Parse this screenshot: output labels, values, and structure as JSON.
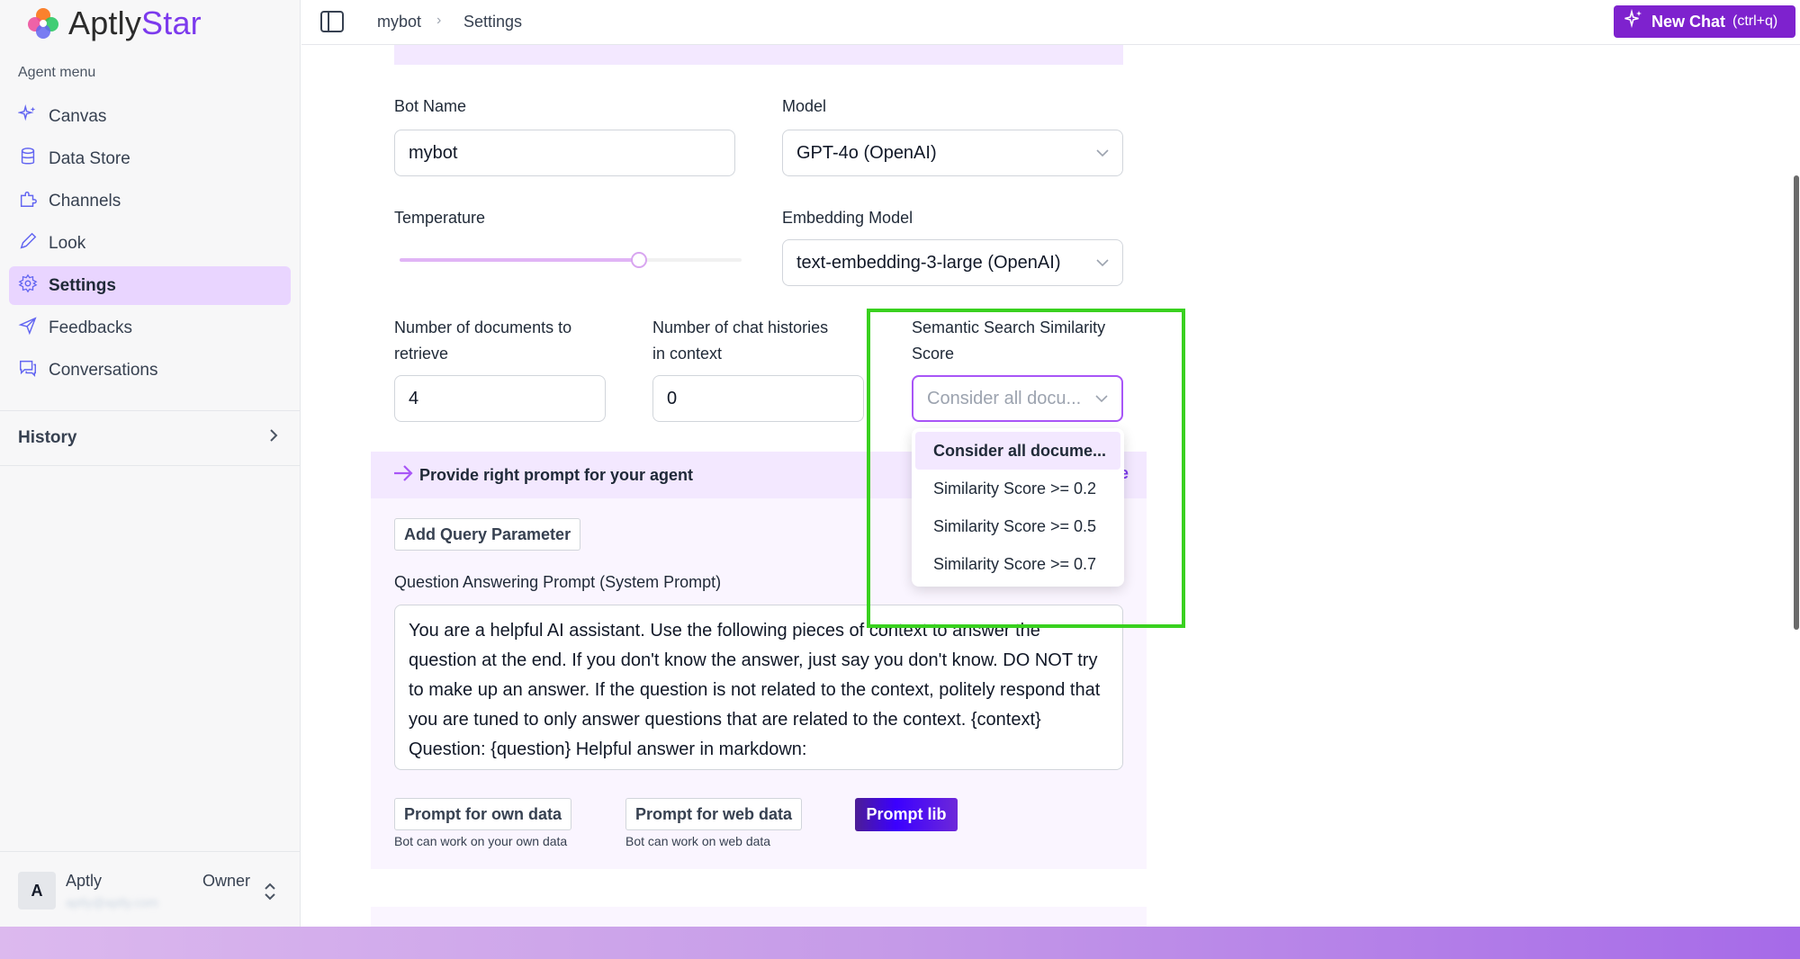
{
  "brand": {
    "name_part1": "Aptly",
    "name_part2": "Star"
  },
  "sidebar": {
    "section_label": "Agent menu",
    "items": [
      {
        "label": "Canvas",
        "icon": "sparkles-icon"
      },
      {
        "label": "Data Store",
        "icon": "database-icon"
      },
      {
        "label": "Channels",
        "icon": "puzzle-icon"
      },
      {
        "label": "Look",
        "icon": "pen-icon"
      },
      {
        "label": "Settings",
        "icon": "gear-icon",
        "active": true
      },
      {
        "label": "Feedbacks",
        "icon": "send-icon"
      },
      {
        "label": "Conversations",
        "icon": "chat-icon"
      }
    ],
    "history_label": "History"
  },
  "user": {
    "initial": "A",
    "name": "Aptly",
    "email": "aptly@aptly.com",
    "role": "Owner"
  },
  "header": {
    "breadcrumb": [
      "mybot",
      "Settings"
    ],
    "new_chat_label": "New Chat",
    "new_chat_shortcut": "(ctrl+q)"
  },
  "form": {
    "bot_name": {
      "label": "Bot Name",
      "value": "mybot"
    },
    "model": {
      "label": "Model",
      "value": "GPT-4o (OpenAI)"
    },
    "temperature": {
      "label": "Temperature",
      "level": 0.7
    },
    "embedding_model": {
      "label": "Embedding Model",
      "value": "text-embedding-3-large (OpenAI)"
    },
    "num_documents": {
      "label_line1": "Number of documents to",
      "label_line2": "retrieve",
      "value": "4"
    },
    "num_histories": {
      "label_line1": "Number of chat histories",
      "label_line2": "in context",
      "value": "0"
    },
    "similarity": {
      "label_line1": "Semantic Search Similarity",
      "label_line2": "Score",
      "placeholder": "Consider all docu...",
      "options": [
        "Consider all docume...",
        "Similarity Score >= 0.2",
        "Similarity Score >= 0.5",
        "Similarity Score >= 0.7"
      ]
    }
  },
  "prompt": {
    "header": "Provide right prompt for your agent",
    "header_trail": "e",
    "add_query_button": "Add Query Parameter",
    "qa_label": "Question Answering Prompt (System Prompt)",
    "qa_text": "You are a helpful AI assistant. Use the following pieces of context to answer the question at the end. If you don't know the answer, just say you don't know. DO NOT try to make up an answer. If the question is not related to the context, politely respond that you are tuned to only answer questions that are related to the context. {context}  Question: {question} Helpful answer in markdown:",
    "own_data_button": "Prompt for own data",
    "own_data_note": "Bot can work on your own data",
    "web_data_button": "Prompt for web data",
    "web_data_note": "Bot can work on web data",
    "prompt_lib_button": "Prompt lib"
  },
  "colors": {
    "accent": "#7e22ce",
    "active_nav": "#e9d5ff",
    "highlight": "#39d11f"
  }
}
